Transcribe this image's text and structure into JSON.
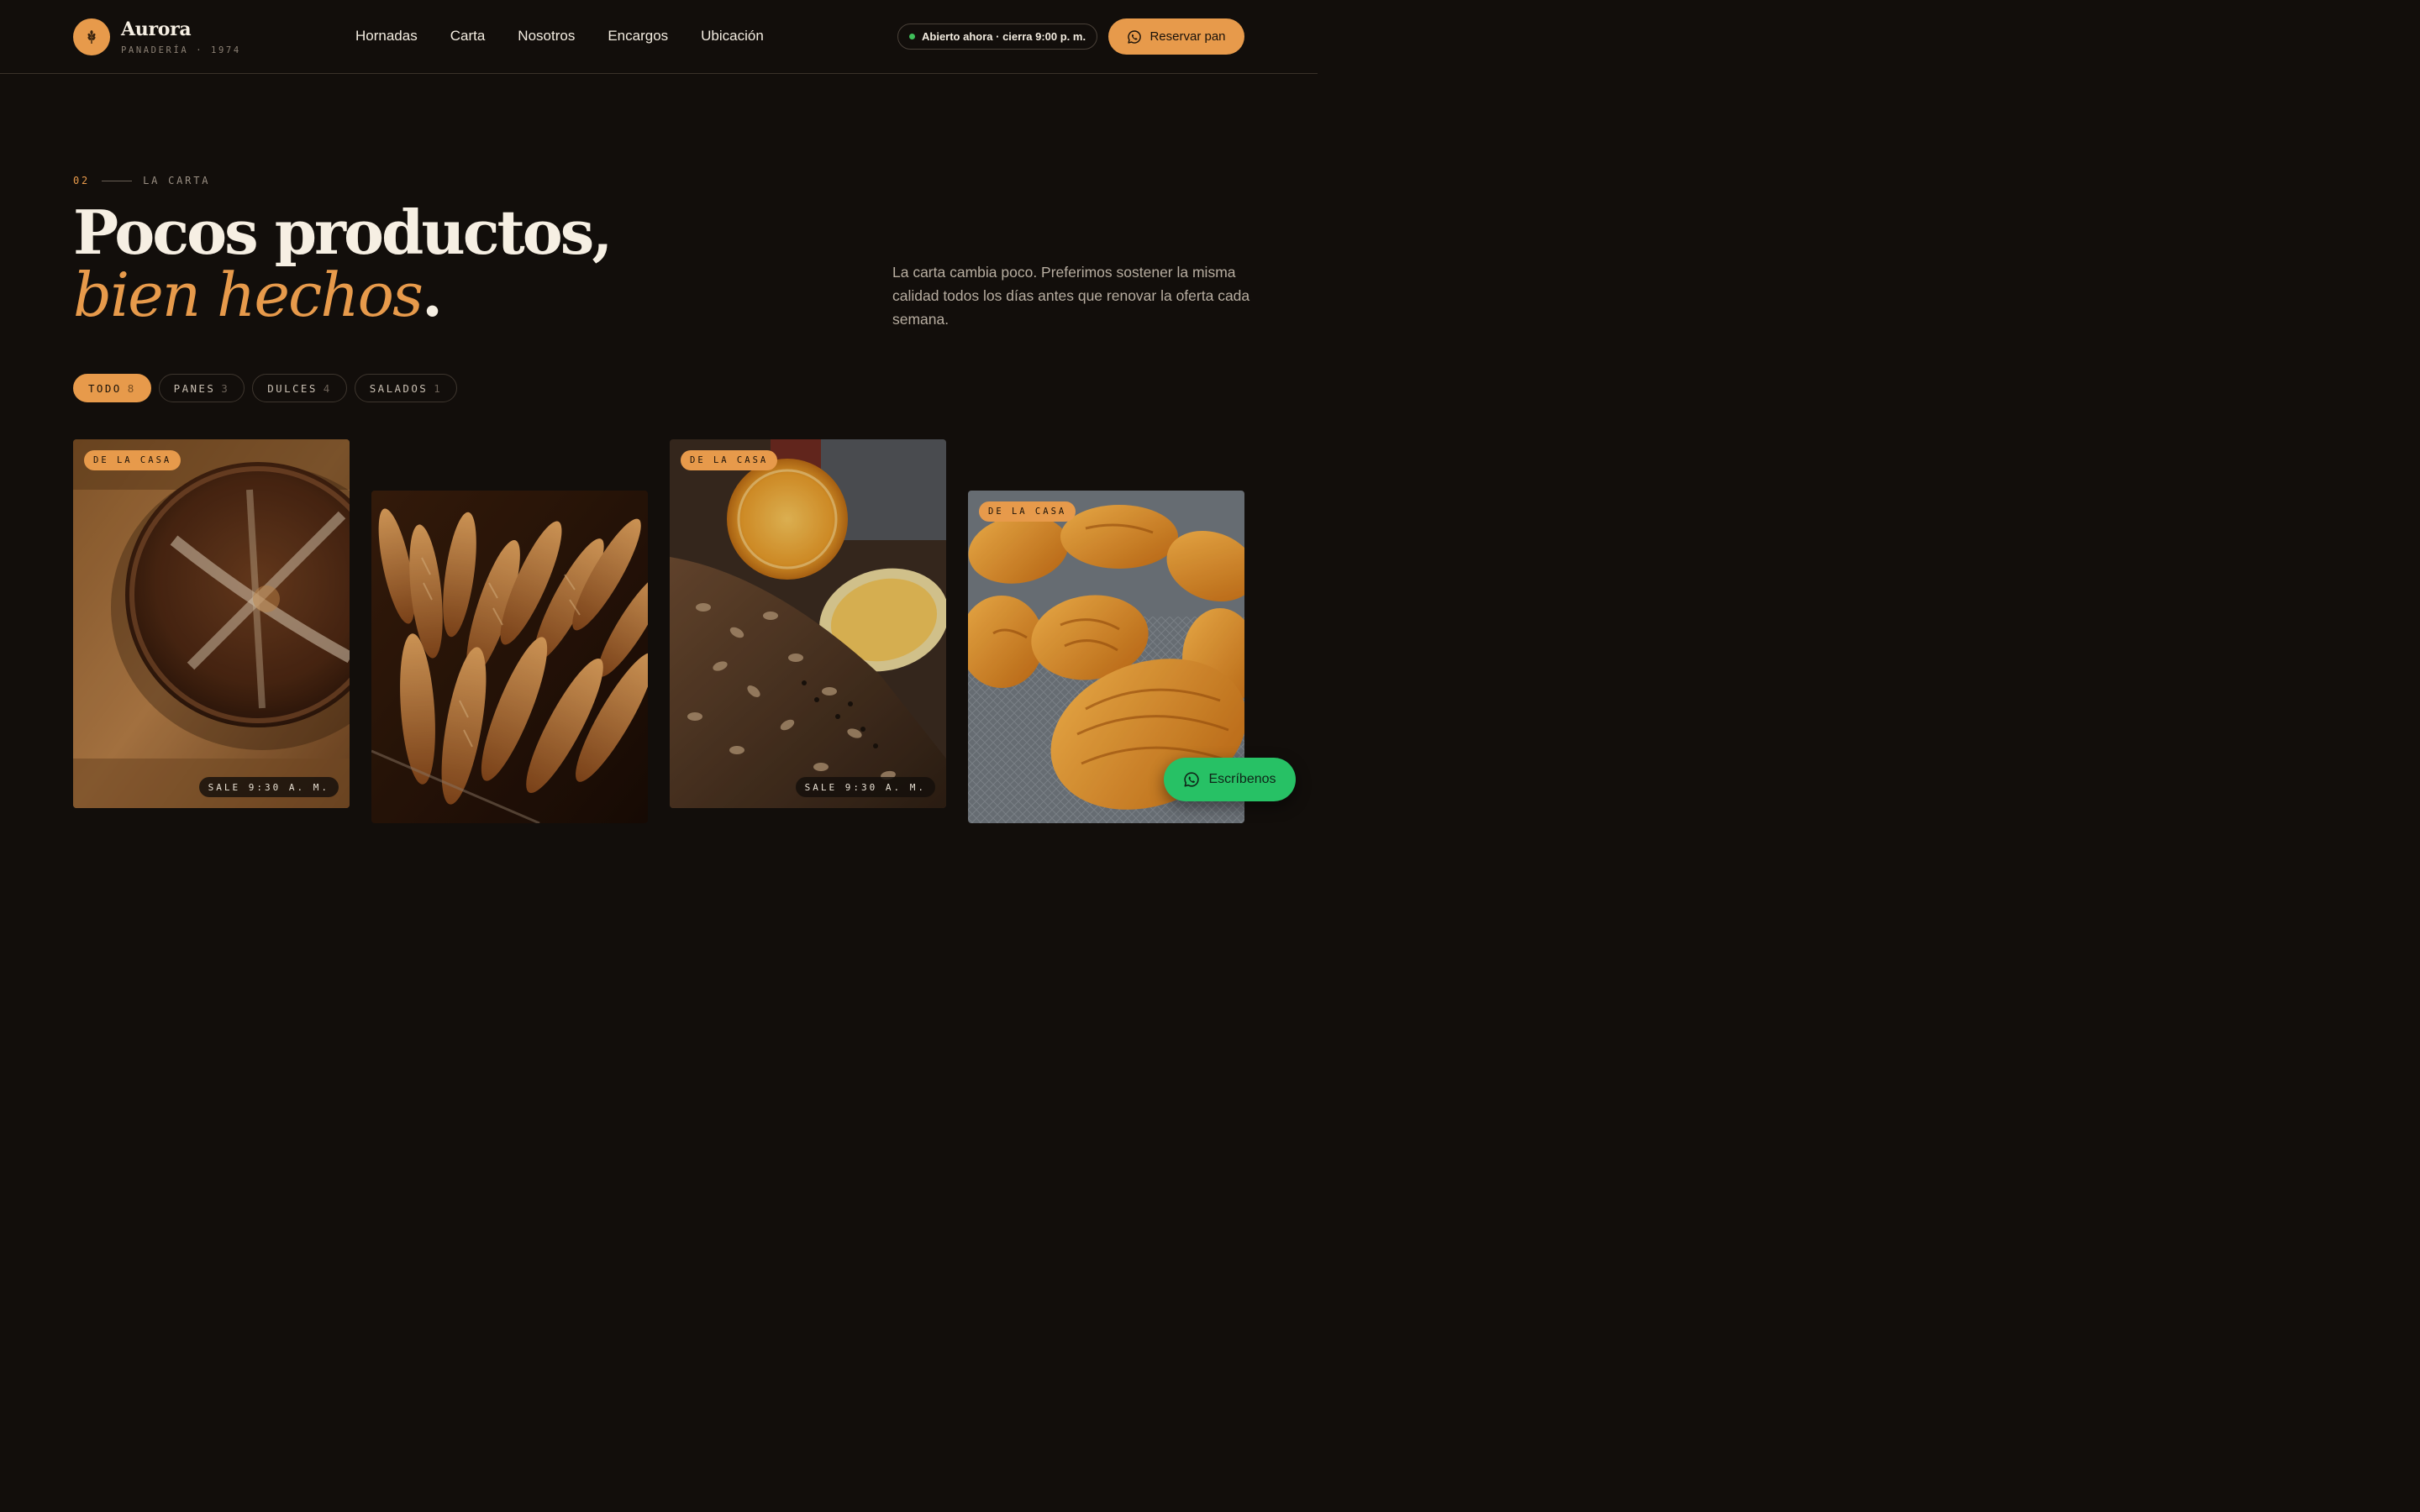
{
  "brand": {
    "name": "Aurora",
    "subtitle": "PANADERÍA · 1974",
    "accent_color": "#e79a4b",
    "logo_icon": "wheat-icon"
  },
  "nav": {
    "links": [
      "Hornadas",
      "Carta",
      "Nosotros",
      "Encargos",
      "Ubicación"
    ]
  },
  "status": {
    "text": "Abierto ahora · cierra 9:00 p. m.",
    "dot_color": "#3fbf5a"
  },
  "header_cta": {
    "label": "Reservar pan",
    "icon": "whatsapp-icon"
  },
  "section": {
    "number": "02",
    "label": "LA CARTA",
    "headline_line1": "Pocos productos,",
    "headline_line2": "bien hechos",
    "headline_dot": ".",
    "intro": "La carta cambia poco. Preferimos sostener la misma calidad todos los días antes que renovar la oferta cada semana."
  },
  "filters": [
    {
      "label": "TODO",
      "count": "8",
      "active": true
    },
    {
      "label": "PANES",
      "count": "3",
      "active": false
    },
    {
      "label": "DULCES",
      "count": "4",
      "active": false
    },
    {
      "label": "SALADOS",
      "count": "1",
      "active": false
    }
  ],
  "products": [
    {
      "image": "sourdough-loaf-photo",
      "badge": "DE LA CASA",
      "time": "SALE 9:30 A. M."
    },
    {
      "image": "baguettes-photo",
      "badge": "",
      "time": ""
    },
    {
      "image": "seeded-bread-lemons-photo",
      "badge": "DE LA CASA",
      "time": "SALE 9:30 A. M."
    },
    {
      "image": "croissants-photo",
      "badge": "DE LA CASA",
      "time": ""
    }
  ],
  "chat": {
    "label": "Escríbenos",
    "icon": "whatsapp-icon",
    "color": "#27c165"
  }
}
